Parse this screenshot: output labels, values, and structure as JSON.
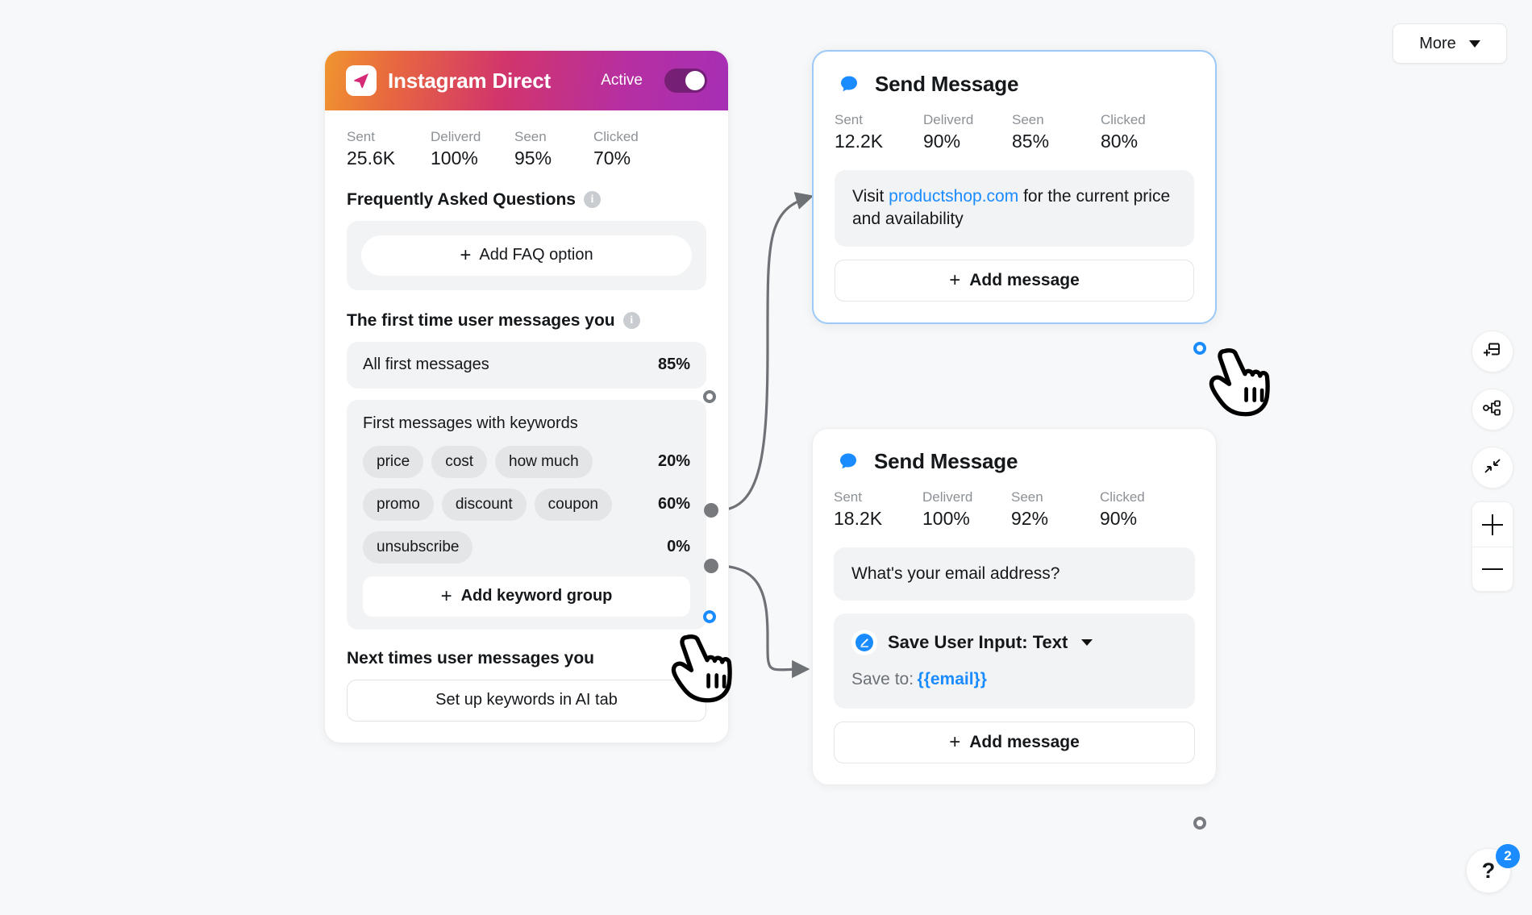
{
  "toolbar_top": {
    "more_label": "More"
  },
  "trigger_card": {
    "title": "Instagram Direct",
    "status_label": "Active",
    "stats": [
      {
        "label": "Sent",
        "value": "25.6K"
      },
      {
        "label": "Deliverd",
        "value": "100%"
      },
      {
        "label": "Seen",
        "value": "95%"
      },
      {
        "label": "Clicked",
        "value": "70%"
      }
    ],
    "faq": {
      "section_title": "Frequently Asked Questions",
      "add_button": "Add FAQ option"
    },
    "first_time": {
      "section_title": "The first time user messages you",
      "all_first_messages": {
        "label": "All first messages",
        "percent": "85%"
      },
      "keyword_group": {
        "caption": "First messages with keywords",
        "rows": [
          {
            "chips": [
              "price",
              "cost",
              "how much"
            ],
            "percent": "20%"
          },
          {
            "chips": [
              "promo",
              "discount",
              "coupon"
            ],
            "percent": "60%"
          },
          {
            "chips": [
              "unsubscribe"
            ],
            "percent": "0%"
          }
        ],
        "add_button": "Add keyword group"
      }
    },
    "next_times": {
      "section_title": "Next times user messages you",
      "button": "Set up keywords in AI tab"
    }
  },
  "message_cards": [
    {
      "title": "Send Message",
      "stats": [
        {
          "label": "Sent",
          "value": "12.2K"
        },
        {
          "label": "Deliverd",
          "value": "90%"
        },
        {
          "label": "Seen",
          "value": "85%"
        },
        {
          "label": "Clicked",
          "value": "80%"
        }
      ],
      "bubble": {
        "before": "Visit ",
        "link": "productshop.com",
        "after": " for the current price and availability"
      },
      "add_message": "Add message"
    },
    {
      "title": "Send Message",
      "stats": [
        {
          "label": "Sent",
          "value": "18.2K"
        },
        {
          "label": "Deliverd",
          "value": "100%"
        },
        {
          "label": "Seen",
          "value": "92%"
        },
        {
          "label": "Clicked",
          "value": "90%"
        }
      ],
      "bubble_text": "What's your email address?",
      "save_input": {
        "title": "Save User Input: Text",
        "save_to_label": "Save to:",
        "variable": "{{email}}"
      },
      "add_message": "Add message"
    }
  ],
  "side_tools": [
    {
      "icon": "add-node-icon"
    },
    {
      "icon": "flow-tree-icon"
    },
    {
      "icon": "fit-screen-icon"
    }
  ],
  "zoom_controls": {
    "zoom_in": "+",
    "zoom_out": "−"
  },
  "help": {
    "glyph": "?",
    "badge": "2"
  },
  "colors": {
    "accent_blue": "#1a8cff",
    "selected_border": "#9cc9f7",
    "canvas_bg": "#f7f8f9",
    "grey_block": "#f2f3f4",
    "chip_bg": "#e3e5e7",
    "edge_grey": "#6e7276"
  }
}
